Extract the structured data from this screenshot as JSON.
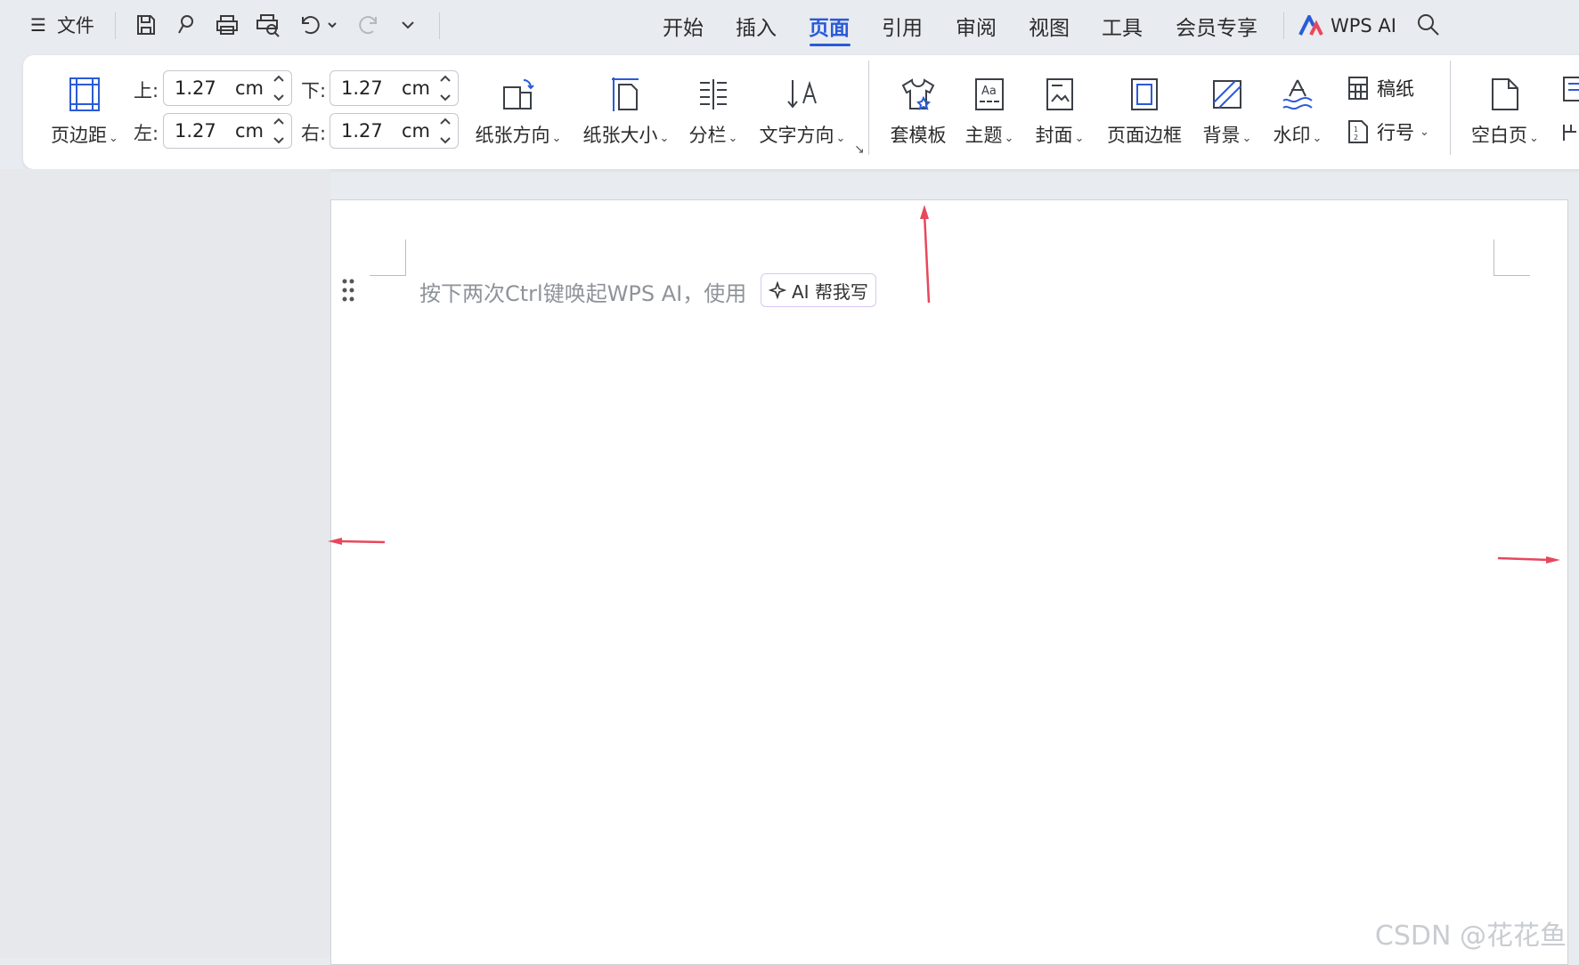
{
  "titlebar": {
    "menu_label": "文件",
    "tabs": [
      "开始",
      "插入",
      "页面",
      "引用",
      "审阅",
      "视图",
      "工具",
      "会员专享"
    ],
    "active_tab": "页面",
    "wps_ai_label": "WPS AI"
  },
  "ribbon": {
    "margins": {
      "label": "页边距",
      "top": {
        "label": "上:",
        "value": "1.27",
        "unit": "cm"
      },
      "bottom": {
        "label": "下:",
        "value": "1.27",
        "unit": "cm"
      },
      "left": {
        "label": "左:",
        "value": "1.27",
        "unit": "cm"
      },
      "right": {
        "label": "右:",
        "value": "1.27",
        "unit": "cm"
      }
    },
    "orientation": "纸张方向",
    "size": "纸张大小",
    "columns": "分栏",
    "text_direction": "文字方向",
    "template": "套模板",
    "theme": "主题",
    "cover": "封面",
    "page_border": "页面边框",
    "background": "背景",
    "watermark": "水印",
    "manuscript": "稿纸",
    "line_number": "行号",
    "blank_page": "空白页"
  },
  "document": {
    "hint": "按下两次Ctrl键唤起WPS AI，使用",
    "ai_button": "AI 帮我写"
  },
  "watermark_text": "CSDN @花花鱼",
  "colors": {
    "accent": "#2a5bd7",
    "annotation_arrow": "#e8475b"
  }
}
